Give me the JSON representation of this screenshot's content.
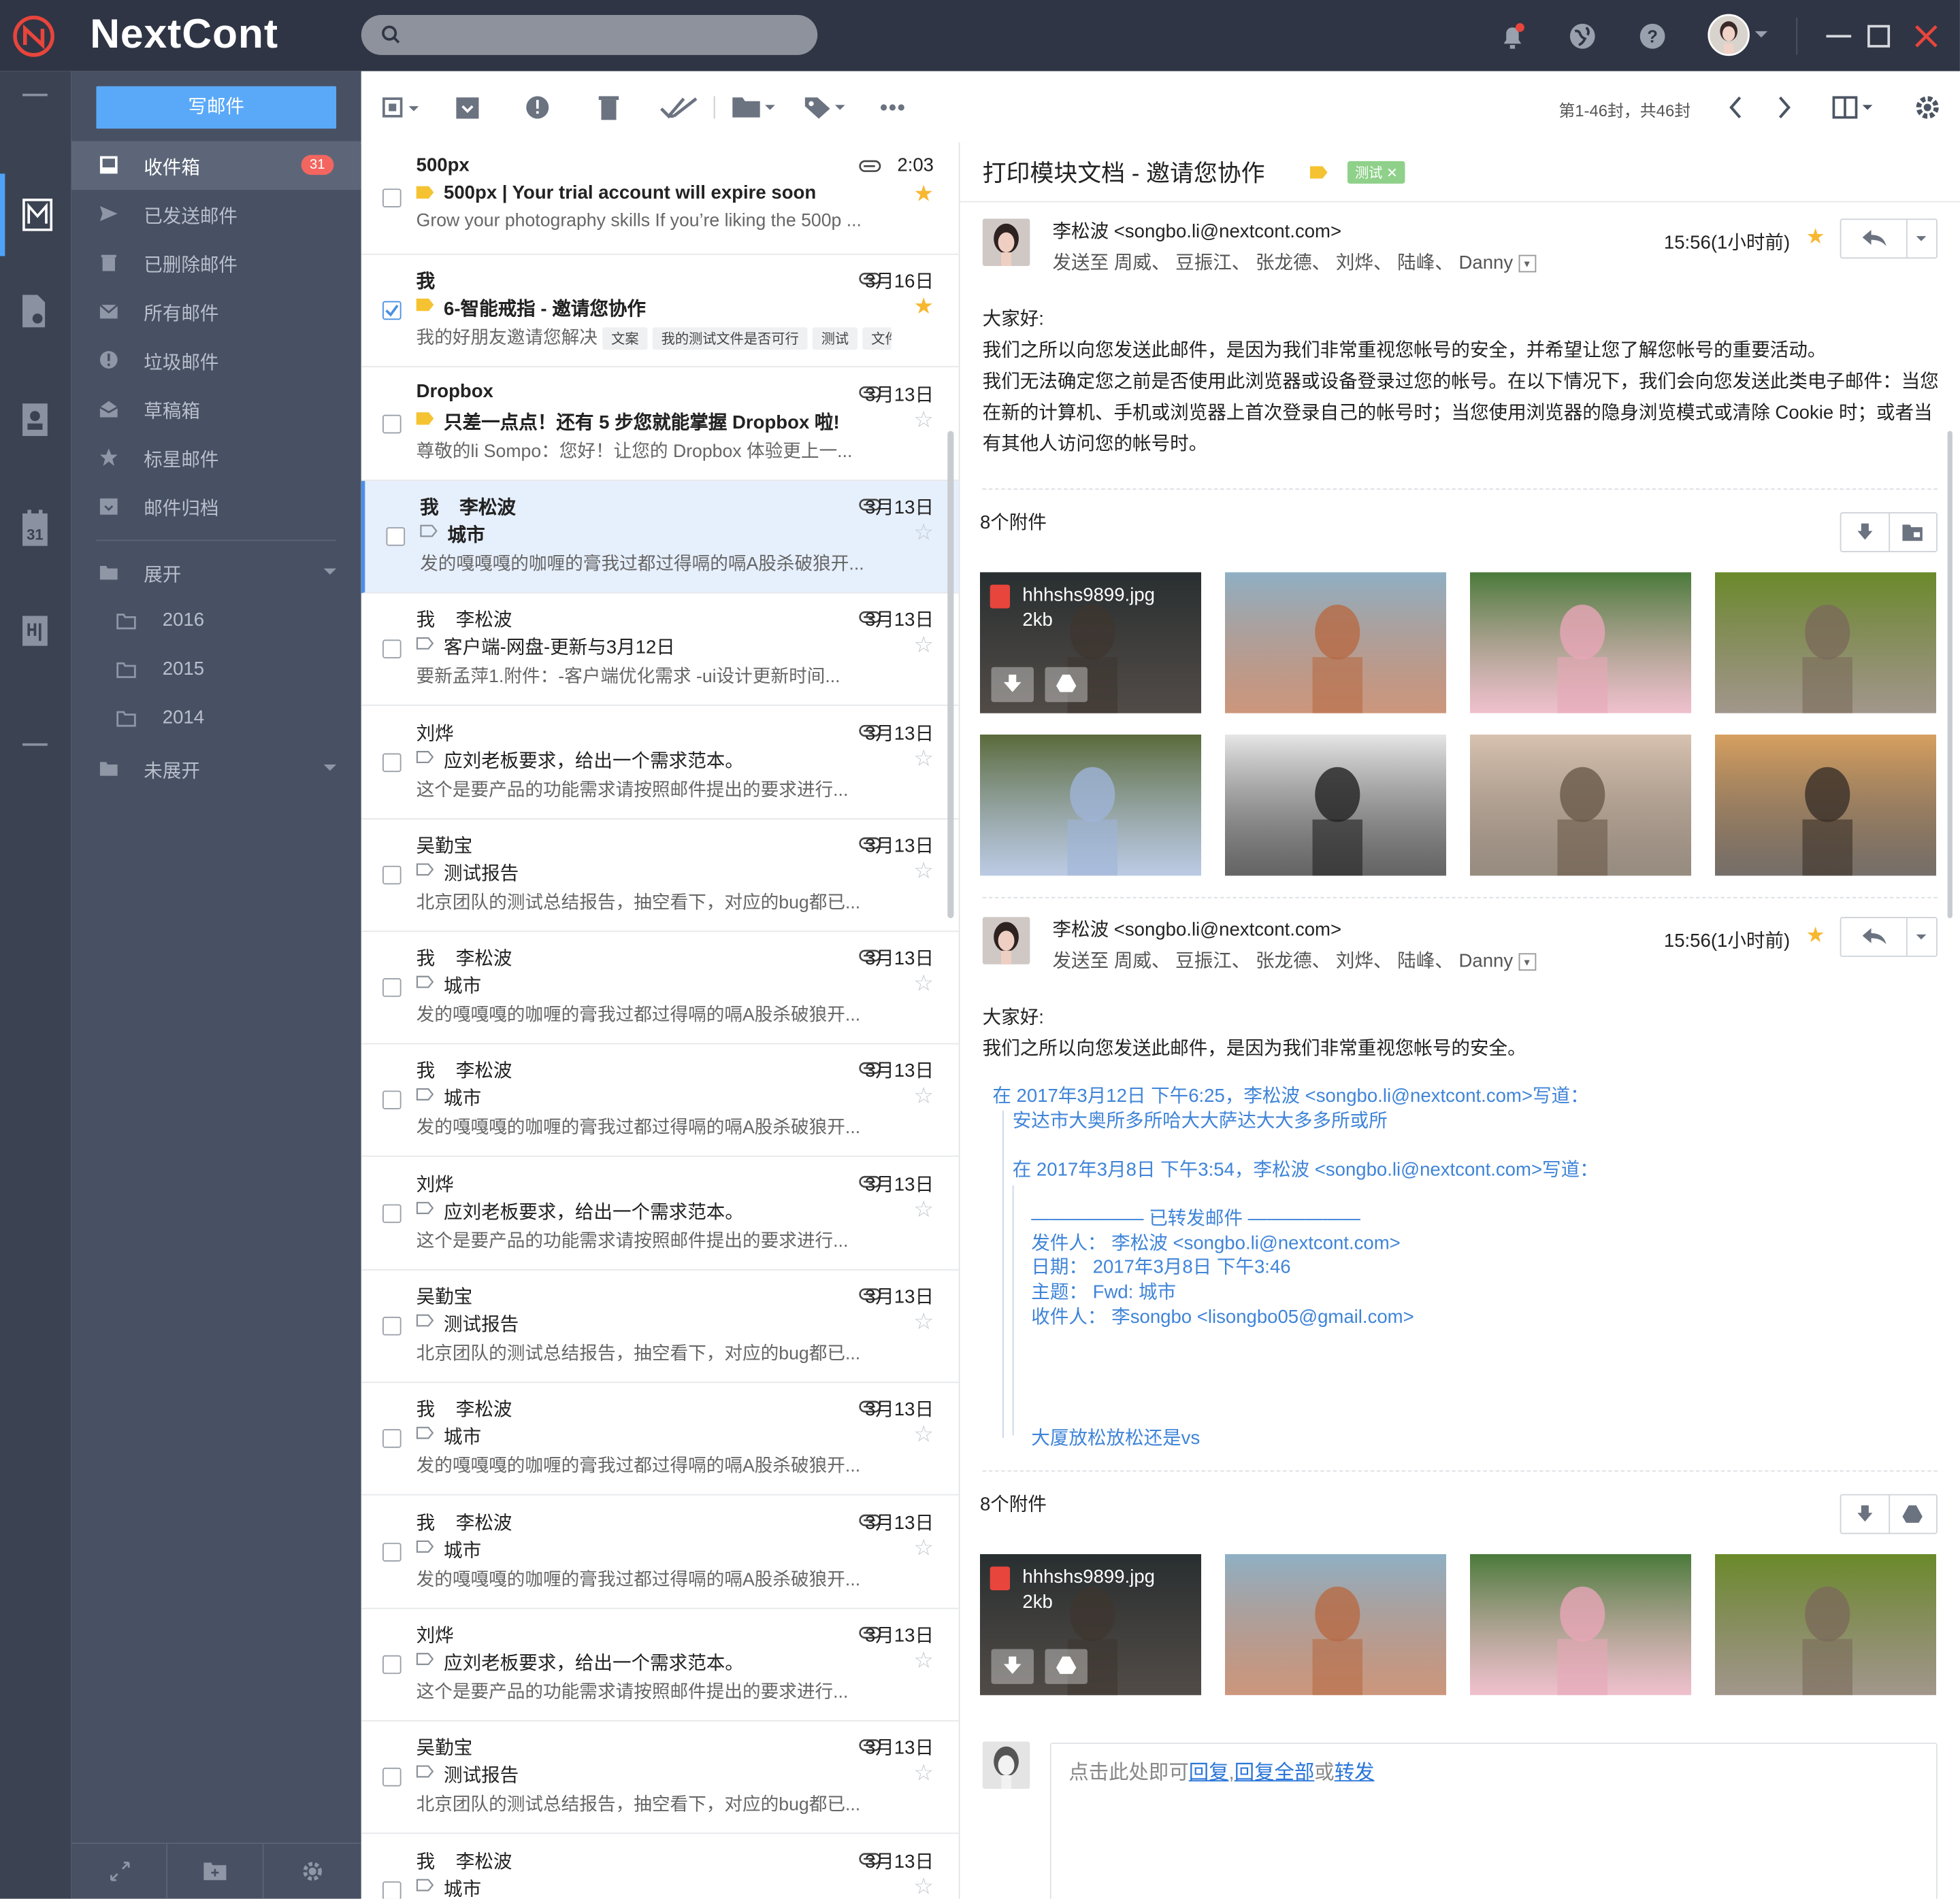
{
  "app": {
    "brand": "NextCont",
    "search_placeholder": ""
  },
  "colors": {
    "accent": "#5aa9f8",
    "topbar": "#2f3544",
    "sidebar": "#485063",
    "rail": "#3b4252",
    "badge": "#f2665f",
    "star": "#f7b730",
    "tag_yellow": "#f5c332",
    "test_tag": "#8fd18a"
  },
  "topbar": {
    "icons": [
      "bell-icon",
      "globe-icon",
      "help-icon",
      "avatar",
      "minimize-icon",
      "maximize-icon",
      "close-icon"
    ]
  },
  "sidebar": {
    "compose_label": "写邮件",
    "items": [
      {
        "label": "收件箱",
        "icon": "inbox-icon",
        "badge": "31"
      },
      {
        "label": "已发送邮件",
        "icon": "send-icon"
      },
      {
        "label": "已删除邮件",
        "icon": "trash-icon"
      },
      {
        "label": "所有邮件",
        "icon": "mail-icon"
      },
      {
        "label": "垃圾邮件",
        "icon": "alert-icon"
      },
      {
        "label": "草稿箱",
        "icon": "draft-icon"
      },
      {
        "label": "标星邮件",
        "icon": "star-icon"
      },
      {
        "label": "邮件归档",
        "icon": "archive-icon"
      }
    ],
    "folders_expanded": "展开",
    "subfolders": [
      "2016",
      "2015",
      "2014"
    ],
    "folders_collapsed": "未展开"
  },
  "toolbar": {
    "page_info": "第1-46封，共46封"
  },
  "list": [
    {
      "from": "500px",
      "date": "2:03",
      "subject": "500px | Your trial account will expire soon",
      "preview": "Grow your photography skills If you’re liking the 500p ...",
      "bold": true,
      "starred": true,
      "tag": "yellow",
      "checked": false,
      "selected": false
    },
    {
      "from": "我",
      "date": "3月16日",
      "subject": "6-智能戒指 - 邀请您协作",
      "preview": "我的好朋友邀请您解决",
      "chips": [
        "文案",
        "我的测试文件是否可行",
        "测试",
        "文件"
      ],
      "bold": true,
      "starred": true,
      "tag": "yellow",
      "checked": true,
      "selected": false
    },
    {
      "from": "Dropbox",
      "date": "3月13日",
      "subject": "只差一点点！还有 5 步您就能掌握 Dropbox 啦!",
      "preview": "尊敬的li Sompo：您好！让您的 Dropbox 体验更上一...",
      "bold": true,
      "starred": false,
      "tag": "yellow",
      "checked": false,
      "selected": false
    },
    {
      "from": "我    李松波",
      "date": "3月13日",
      "subject": "城市",
      "preview": "发的嘎嘎嘎的咖喱的膏我过都过得嗝的嗝A股杀破狼开...",
      "bold": true,
      "starred": false,
      "tag": "outline",
      "checked": false,
      "selected": true
    },
    {
      "from": "我    李松波",
      "date": "3月13日",
      "subject": "客户端-网盘-更新与3月12日",
      "preview": "要新孟萍1.附件：-客户端优化需求  -ui设计更新时间...",
      "bold": false,
      "starred": false,
      "tag": "outline",
      "checked": false,
      "selected": false
    },
    {
      "from": "刘烨",
      "date": "3月13日",
      "subject": "应刘老板要求，给出一个需求范本。",
      "preview": "这个是要产品的功能需求请按照邮件提出的要求进行...",
      "bold": false,
      "starred": false,
      "tag": "outline",
      "checked": false,
      "selected": false
    },
    {
      "from": "吴勤宝",
      "date": "3月13日",
      "subject": "测试报告",
      "preview": "北京团队的测试总结报告，抽空看下，对应的bug都已...",
      "bold": false,
      "starred": false,
      "tag": "outline",
      "checked": false,
      "selected": false
    },
    {
      "from": "我    李松波",
      "date": "3月13日",
      "subject": "城市",
      "preview": "发的嘎嘎嘎的咖喱的膏我过都过得嗝的嗝A股杀破狼开...",
      "bold": false,
      "starred": false,
      "tag": "outline",
      "checked": false,
      "selected": false
    },
    {
      "from": "我    李松波",
      "date": "3月13日",
      "subject": "城市",
      "preview": "发的嘎嘎嘎的咖喱的膏我过都过得嗝的嗝A股杀破狼开...",
      "bold": false,
      "starred": false,
      "tag": "outline",
      "checked": false,
      "selected": false
    },
    {
      "from": "刘烨",
      "date": "3月13日",
      "subject": "应刘老板要求，给出一个需求范本。",
      "preview": "这个是要产品的功能需求请按照邮件提出的要求进行...",
      "bold": false,
      "starred": false,
      "tag": "outline",
      "checked": false,
      "selected": false
    },
    {
      "from": "吴勤宝",
      "date": "3月13日",
      "subject": "测试报告",
      "preview": "北京团队的测试总结报告，抽空看下，对应的bug都已...",
      "bold": false,
      "starred": false,
      "tag": "outline",
      "checked": false,
      "selected": false
    },
    {
      "from": "我    李松波",
      "date": "3月13日",
      "subject": "城市",
      "preview": "发的嘎嘎嘎的咖喱的膏我过都过得嗝的嗝A股杀破狼开...",
      "bold": false,
      "starred": false,
      "tag": "outline",
      "checked": false,
      "selected": false
    },
    {
      "from": "我    李松波",
      "date": "3月13日",
      "subject": "城市",
      "preview": "发的嘎嘎嘎的咖喱的膏我过都过得嗝的嗝A股杀破狼开...",
      "bold": false,
      "starred": false,
      "tag": "outline",
      "checked": false,
      "selected": false
    },
    {
      "from": "刘烨",
      "date": "3月13日",
      "subject": "应刘老板要求，给出一个需求范本。",
      "preview": "这个是要产品的功能需求请按照邮件提出的要求进行...",
      "bold": false,
      "starred": false,
      "tag": "outline",
      "checked": false,
      "selected": false
    },
    {
      "from": "吴勤宝",
      "date": "3月13日",
      "subject": "测试报告",
      "preview": "北京团队的测试总结报告，抽空看下，对应的bug都已...",
      "bold": false,
      "starred": false,
      "tag": "outline",
      "checked": false,
      "selected": false
    },
    {
      "from": "我    李松波",
      "date": "3月13日",
      "subject": "城市",
      "preview": "",
      "bold": false,
      "starred": false,
      "tag": "outline",
      "checked": false,
      "selected": false
    }
  ],
  "reader": {
    "title": "打印模块文档 - 邀请您协作",
    "tag_label": "测试",
    "messages": [
      {
        "sender": "李松波  <songbo.li@nextcont.com>",
        "to_prefix": "发送至",
        "recipients": "周威、 豆振江、 张龙德、 刘烨、 陆峰、 Danny",
        "time": "15:56(1小时前)",
        "greeting": "大家好:",
        "body": [
          "我们之所以向您发送此邮件，是因为我们非常重视您帐号的安全，并希望让您了解您帐号的重要活动。",
          "我们无法确定您之前是否使用此浏览器或设备登录过您的帐号。在以下情况下，我们会向您发送此类电子邮件：当您在新的计算机、手机或浏览器上首次登录自己的帐号时；当您使用浏览器的隐身浏览模式或清除 Cookie 时；或者当有其他人访问您的帐号时。"
        ]
      },
      {
        "sender": "李松波  <songbo.li@nextcont.com>",
        "to_prefix": "发送至",
        "recipients": "周威、 豆振江、 张龙德、 刘烨、 陆峰、 Danny",
        "time": "15:56(1小时前)",
        "greeting": "大家好:",
        "body": [
          "我们之所以向您发送此邮件，是因为我们非常重视您帐号的安全。"
        ]
      }
    ],
    "attachments_label": "8个附件",
    "attachment_file": {
      "name": "hhhshs9899.jpg",
      "size": "2kb"
    },
    "quote": {
      "line1": "在 2017年3月12日 下午6:25，李松波 <songbo.li@nextcont.com>写道：",
      "line2": "安达市大奥所多所哈大大萨达大大多多所或所",
      "line3": "在 2017年3月8日 下午3:54，李松波 <songbo.li@nextcont.com>写道：",
      "fwd_header": "—————— 已转发邮件 ——————",
      "from_label": "发件人：",
      "from_value": "李松波 <songbo.li@nextcont.com>",
      "date_label": "日期：",
      "date_value": "2017年3月8日 下午3:46",
      "subject_label": "主题：",
      "subject_value": "Fwd: 城市",
      "to_label": "收件人：",
      "to_value": "李songbo <lisongbo05@gmail.com>",
      "tail": "大厦放松放松还是vs"
    },
    "reply_box": {
      "prefix": "点击此处即可",
      "reply": "回复",
      "sep1": ",",
      "reply_all": "回复全部",
      "or": "或",
      "forward": "转发"
    }
  }
}
